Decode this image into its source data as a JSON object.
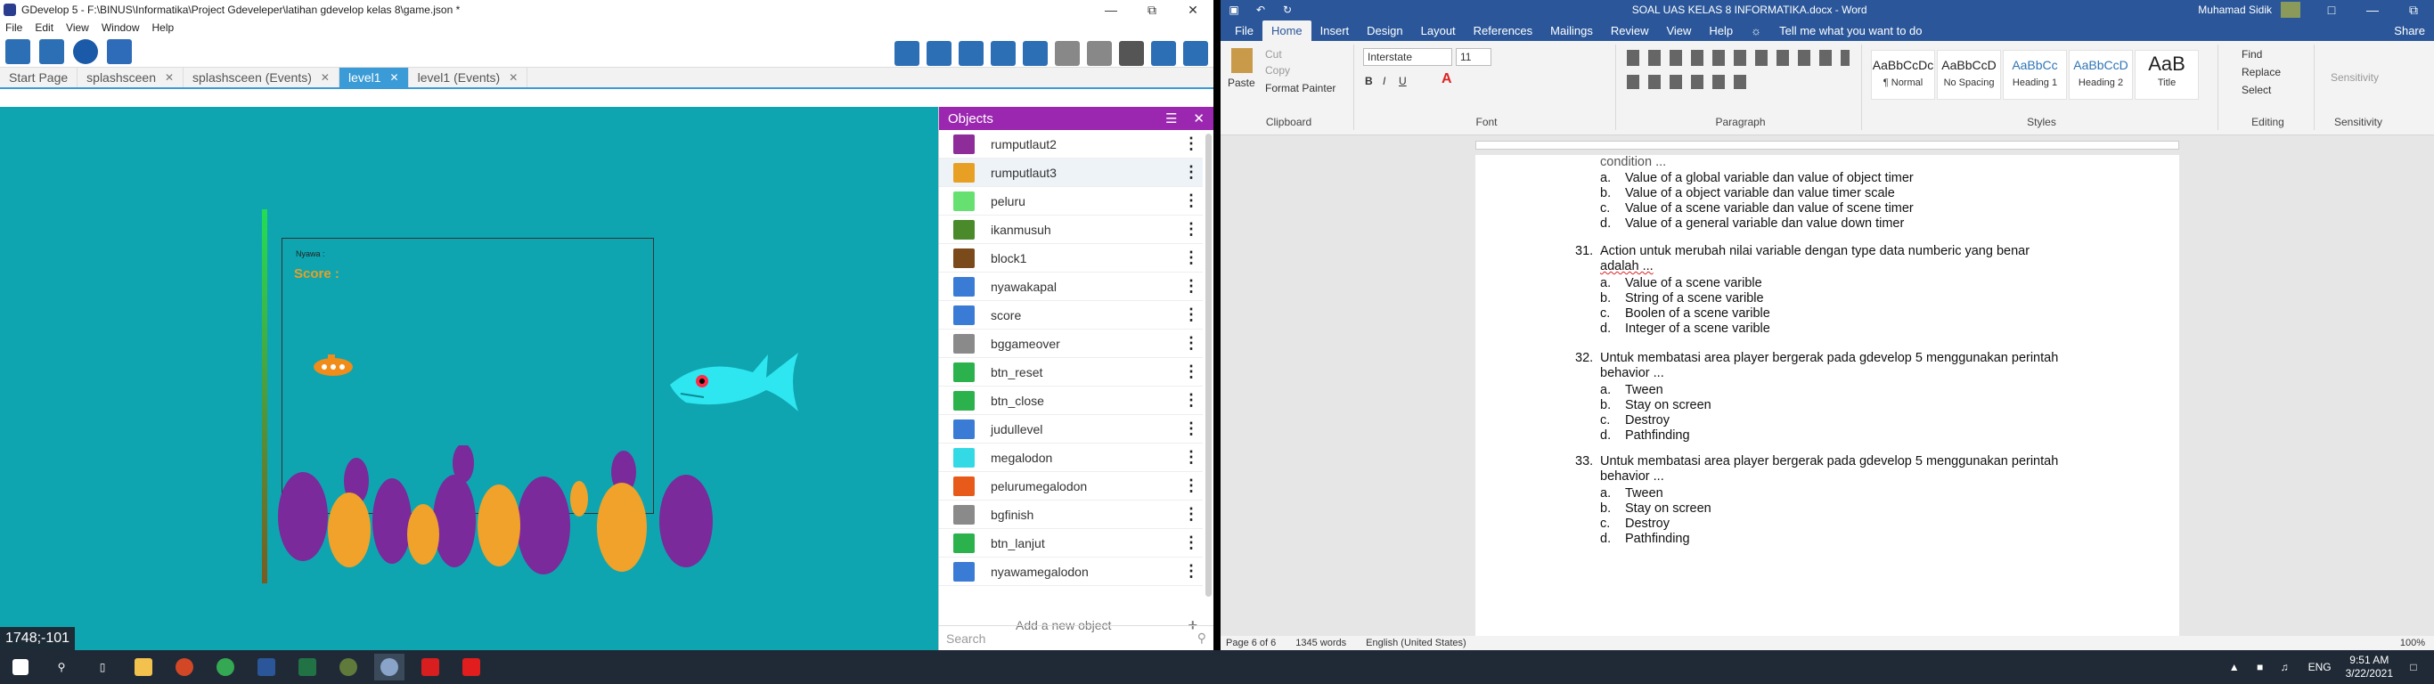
{
  "gdevelop": {
    "title": "GDevelop 5 - F:\\BINUS\\Informatika\\Project Gdeveleper\\latihan gdevelop kelas 8\\game.json *",
    "menu": [
      "File",
      "Edit",
      "View",
      "Window",
      "Help"
    ],
    "tabs": [
      {
        "label": "Start Page",
        "closable": false
      },
      {
        "label": "splashsceen",
        "closable": true
      },
      {
        "label": "splashsceen (Events)",
        "closable": true
      },
      {
        "label": "level1",
        "closable": true,
        "active": true
      },
      {
        "label": "level1 (Events)",
        "closable": true
      }
    ],
    "scene": {
      "nyawa_label": "Nyawa :",
      "score_label": "Score :",
      "coords": "1748;-101",
      "bg_color": "#0ea5b0"
    },
    "objects_panel": {
      "title": "Objects",
      "items": [
        {
          "name": "rumputlaut2",
          "color": "#8e2c9a"
        },
        {
          "name": "rumputlaut3",
          "color": "#e8a024"
        },
        {
          "name": "peluru",
          "color": "#66e070"
        },
        {
          "name": "ikanmusuh",
          "color": "#4a8a2a"
        },
        {
          "name": "block1",
          "color": "#7a4a1a"
        },
        {
          "name": "nyawakapal",
          "color": "#3a7bd5"
        },
        {
          "name": "score",
          "color": "#3a7bd5"
        },
        {
          "name": "bggameover",
          "color": "#8a8a8a"
        },
        {
          "name": "btn_reset",
          "color": "#2bb24c"
        },
        {
          "name": "btn_close",
          "color": "#2bb24c"
        },
        {
          "name": "judullevel",
          "color": "#3a7bd5"
        },
        {
          "name": "megalodon",
          "color": "#34d9e6"
        },
        {
          "name": "pelurumegalodon",
          "color": "#e85a1a"
        },
        {
          "name": "bgfinish",
          "color": "#8a8a8a"
        },
        {
          "name": "btn_lanjut",
          "color": "#2bb24c"
        },
        {
          "name": "nyawamegalodon",
          "color": "#3a7bd5"
        }
      ],
      "add_label": "Add a new object",
      "search_placeholder": "Search"
    }
  },
  "word": {
    "title": "SOAL UAS KELAS 8 INFORMATIKA.docx - Word",
    "user": "Muhamad Sidik",
    "share": "Share",
    "tabs": [
      "File",
      "Home",
      "Insert",
      "Design",
      "Layout",
      "References",
      "Mailings",
      "Review",
      "View",
      "Help"
    ],
    "tell_me": "Tell me what you want to do",
    "clipboard": {
      "paste": "Paste",
      "cut": "Cut",
      "copy": "Copy",
      "format_painter": "Format Painter",
      "label": "Clipboard"
    },
    "font": {
      "name": "Interstate",
      "size": "11",
      "label": "Font"
    },
    "paragraph_label": "Paragraph",
    "styles": [
      {
        "preview": "AaBbCcDc",
        "name": "¶ Normal"
      },
      {
        "preview": "AaBbCcD",
        "name": "No Spacing"
      },
      {
        "preview": "AaBbCc",
        "name": "Heading 1"
      },
      {
        "preview": "AaBbCcD",
        "name": "Heading 2"
      },
      {
        "preview": "AaB",
        "name": "Title"
      }
    ],
    "styles_label": "Styles",
    "editing": {
      "find": "Find",
      "replace": "Replace",
      "select": "Select",
      "label": "Editing"
    },
    "sensitivity": {
      "button": "Sensitivity",
      "label": "Sensitivity"
    },
    "doc": {
      "partial_line": "condition ...",
      "q30_options": [
        {
          "l": "a.",
          "t": "Value of a global variable dan value of object timer"
        },
        {
          "l": "b.",
          "t": "Value of a object variable dan value timer scale"
        },
        {
          "l": "c.",
          "t": "Value of a scene variable dan value of scene timer"
        },
        {
          "l": "d.",
          "t": "Value of a general variable dan value down timer"
        }
      ],
      "q31": {
        "num": "31.",
        "line1": "Action untuk merubah nilai variable dengan type data numberic yang benar",
        "line2": "adalah ..."
      },
      "q31_options": [
        {
          "l": "a.",
          "t": "Value of a scene varible"
        },
        {
          "l": "b.",
          "t": "String of a scene varible"
        },
        {
          "l": "c.",
          "t": "Boolen of a scene varible"
        },
        {
          "l": "d.",
          "t": "Integer of a scene varible"
        }
      ],
      "q32": {
        "num": "32.",
        "line1": "Untuk membatasi area player bergerak pada gdevelop 5 menggunakan perintah",
        "line2": "behavior ..."
      },
      "q32_options": [
        {
          "l": "a.",
          "t": "Tween"
        },
        {
          "l": "b.",
          "t": "Stay on screen"
        },
        {
          "l": "c.",
          "t": "Destroy"
        },
        {
          "l": "d.",
          "t": "Pathfinding"
        }
      ],
      "q33": {
        "num": "33.",
        "line1": "Untuk membatasi area player bergerak pada gdevelop 5 menggunakan perintah",
        "line2": "behavior ..."
      },
      "q33_options": [
        {
          "l": "a.",
          "t": "Tween"
        },
        {
          "l": "b.",
          "t": "Stay on screen"
        },
        {
          "l": "c.",
          "t": "Destroy"
        },
        {
          "l": "d.",
          "t": "Pathfinding"
        }
      ]
    },
    "status": {
      "page": "Page 6 of 6",
      "words": "1345 words",
      "language": "English (United States)",
      "zoom": "100%"
    }
  },
  "taskbar": {
    "lang": "ENG",
    "time": "9:51 AM",
    "date": "3/22/2021"
  }
}
